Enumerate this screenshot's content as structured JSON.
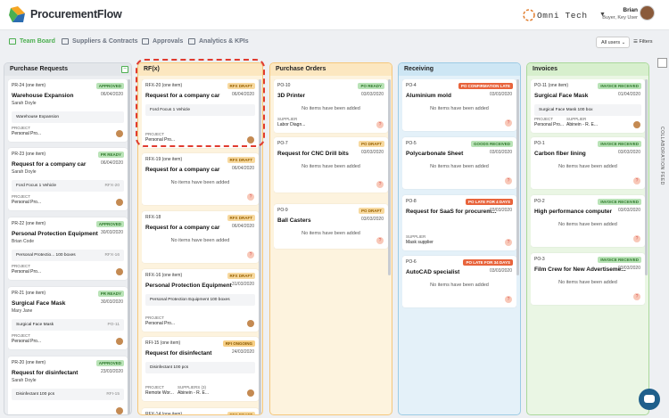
{
  "app": {
    "brand": "ProcurementFlow",
    "company": "Omni Tech",
    "user_name": "Brian",
    "user_role": "Buyer, Key User"
  },
  "nav": [
    {
      "label": "Team Board"
    },
    {
      "label": "Suppliers & Contracts"
    },
    {
      "label": "Approvals"
    },
    {
      "label": "Analytics & KPIs"
    }
  ],
  "toolbar": {
    "all_users": "All users",
    "filters": "Filters"
  },
  "sidebar": {
    "label": "COLLABORATION FEED"
  },
  "colors": {
    "accent": "#4caf50",
    "approved": "#7cc47f",
    "pending": "#f3b43c",
    "late": "#e8643c",
    "orange": "#f6a623"
  },
  "columns": [
    {
      "title": "Purchase Requests",
      "cards": [
        {
          "id": "PR-24",
          "line": "(one item)",
          "badge": "APPROVED",
          "title": "Warehouse Expansion",
          "date": "06/04/2020",
          "person": "Sarah Doyle",
          "item": "Warehouse Expansion",
          "project_label": "PROJECT",
          "project": "Personal Pro..."
        },
        {
          "id": "PR-23",
          "line": "(one item)",
          "badge": "PR READY",
          "title": "Request for a company car",
          "date": "06/04/2020",
          "person": "Sarah Doyle",
          "item": "Ford Focus  1 Vehicle",
          "item_ref": "RFX-20",
          "project_label": "PROJECT",
          "project": "Personal Pro..."
        },
        {
          "id": "PR-22",
          "line": "(one item)",
          "badge": "APPROVED",
          "title": "Personal Protection Equipment",
          "date": "30/03/2020",
          "person": "Brian Code",
          "item": "Personal Protectio...  100 boxes",
          "item_ref": "RFX-16",
          "project_label": "PROJECT",
          "project": "Personal Pro..."
        },
        {
          "id": "PR-21",
          "line": "(one item)",
          "badge": "PR READY",
          "title": "Surgical Face Mask",
          "date": "30/03/2020",
          "person": "Mary Jane",
          "item": "Surgical Face Mask",
          "item_ref": "PO-11",
          "project_label": "PROJECT",
          "project": "Personal Pro..."
        },
        {
          "id": "PR-20",
          "line": "(one item)",
          "badge": "APPROVED",
          "title": "Request for disinfectant",
          "date": "23/03/2020",
          "person": "Sarah Doyle",
          "item": "Disinfectant  100 pcs",
          "item_ref": "RFI-15"
        }
      ]
    },
    {
      "title": "RF(x)",
      "cards": [
        {
          "id": "RFX-20",
          "line": "(one item)",
          "badge": "RFX DRAFT",
          "title": "Request for a company car",
          "date": "06/04/2020",
          "item": "Ford Focus  1 Vehicle",
          "project_label": "PROJECT",
          "project": "Personal Pro..."
        },
        {
          "id": "RFX-19",
          "line": "(one item)",
          "badge": "RFX DRAFT",
          "title": "Request for a company car",
          "date": "06/04/2020",
          "noitems": "No items have been added"
        },
        {
          "id": "RFX-18",
          "badge": "RFX DRAFT",
          "title": "Request for a company car",
          "date": "06/04/2020",
          "noitems": "No items have been added"
        },
        {
          "id": "RFX-16",
          "line": "(one item)",
          "badge": "RFX DRAFT",
          "title": "Personal Protection Equipment",
          "date": "31/03/2020",
          "item": "Personal Protection Equipment  100 boxes",
          "project_label": "PROJECT",
          "project": "Personal Pro..."
        },
        {
          "id": "RFI-15",
          "line": "(one item)",
          "badge": "RFI ONGOING",
          "title": "Request for disinfectant",
          "date": "24/03/2020",
          "item": "Disinfectant  100 pcs",
          "project_label": "PROJECT",
          "project": "Remote Wor...",
          "supplier_label": "SUPPLIERS (3)",
          "supplier": "Abinein - R. E..."
        },
        {
          "id": "RFX-14",
          "line": "(one item)",
          "badge": "RFX DRAFT"
        }
      ]
    },
    {
      "title": "Purchase Orders",
      "cards": [
        {
          "id": "PO-10",
          "badge": "PO READY",
          "title": "3D Printer",
          "date": "03/03/2020",
          "noitems": "No items have been added",
          "supplier_label": "SUPPLIER",
          "supplier": "Labor Diagn..."
        },
        {
          "id": "PO-7",
          "badge": "PO DRAFT",
          "title": "Request for CNC Drill bits",
          "date": "03/03/2020",
          "noitems": "No items have been added"
        },
        {
          "id": "PO-9",
          "badge": "PO DRAFT",
          "title": "Ball Casters",
          "date": "03/03/2020",
          "noitems": "No items have been added"
        }
      ]
    },
    {
      "title": "Receiving",
      "cards": [
        {
          "id": "PO-4",
          "badge": "PO CONFIRMATION LATE",
          "title": "Aluminium mold",
          "date": "03/03/2020",
          "noitems": "No items have been added"
        },
        {
          "id": "PO-5",
          "badge": "GOODS RECEIVED",
          "title": "Polycarbonate Sheet",
          "date": "03/03/2020",
          "noitems": "No items have been added"
        },
        {
          "id": "PO-8",
          "badge": "PO LATE FOR 4 DAYS",
          "title": "Request for SaaS for procurem...",
          "date": "03/03/2020",
          "supplier_label": "SUPPLIER",
          "supplier": "Mask supplier"
        },
        {
          "id": "PO-6",
          "badge": "PO LATE FOR 34 DAYS",
          "title": "AutoCAD specialist",
          "date": "03/03/2020",
          "noitems": "No items have been added"
        }
      ]
    },
    {
      "title": "Invoices",
      "cards": [
        {
          "id": "PO-11",
          "line": "(one item)",
          "badge": "INVOICE RECEIVED",
          "title": "Surgical Face Mask",
          "date": "01/04/2020",
          "item": "Surgical Face Mask  100 box",
          "project_label": "PROJECT",
          "project": "Personal Pro...",
          "supplier_label": "SUPPLIER",
          "supplier": "Abinein - R. E..."
        },
        {
          "id": "PO-1",
          "badge": "INVOICE RECEIVED",
          "title": "Carbon fiber lining",
          "date": "03/03/2020",
          "noitems": "No items have been added"
        },
        {
          "id": "PO-2",
          "badge": "INVOICE RECEIVED",
          "title": "High performance computer",
          "date": "03/03/2020",
          "noitems": "No items have been added"
        },
        {
          "id": "PO-3",
          "badge": "INVOICE RECEIVED",
          "title": "Film Crew for New Advertiseme...",
          "date": "03/03/2020",
          "noitems": "No items have been added"
        }
      ]
    }
  ]
}
